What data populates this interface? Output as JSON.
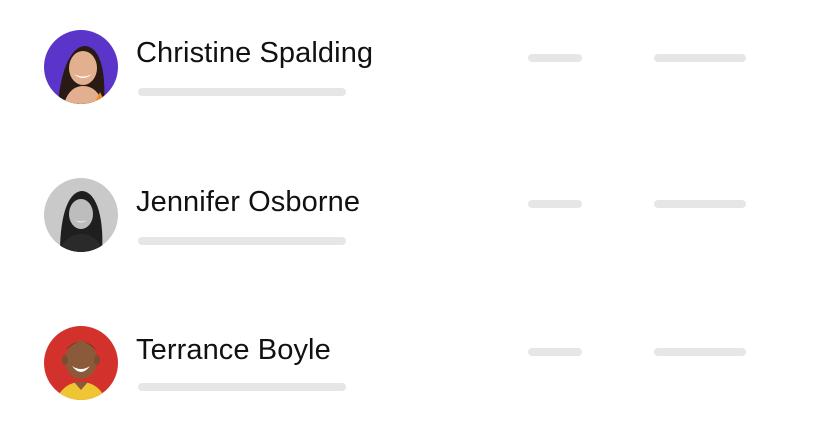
{
  "contacts": [
    {
      "name": "Christine Spalding",
      "avatar": {
        "icon": "avatar-christine-photo",
        "bg": "#5b35c9",
        "skin": "#e2b08f",
        "hair": "#2a1a14",
        "top": "#f08a24"
      }
    },
    {
      "name": "Jennifer Osborne",
      "avatar": {
        "icon": "avatar-jennifer-photo",
        "bg": "#c9c9c9",
        "skin": "#bdbdbd",
        "hair": "#1f1f1f",
        "top": "#2a2a2a"
      }
    },
    {
      "name": "Terrance Boyle",
      "avatar": {
        "icon": "avatar-terrance-photo",
        "bg": "#d3312c",
        "skin": "#8a5a3a",
        "hair": "#2a1810",
        "top": "#f0c534"
      }
    }
  ],
  "colors": {
    "placeholder_bar": "#e6e6e6",
    "name_text": "#111111"
  }
}
